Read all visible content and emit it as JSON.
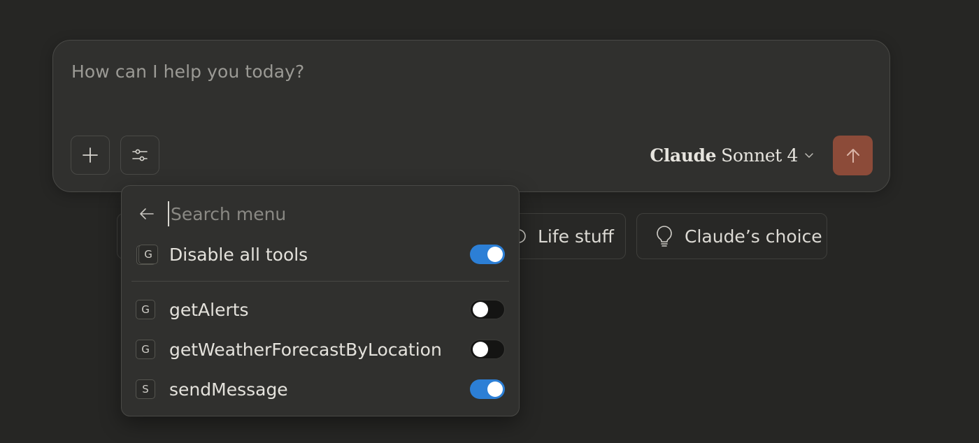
{
  "composer": {
    "placeholder": "How can I help you today?",
    "model_brand": "Claude",
    "model_variant": "Sonnet 4"
  },
  "suggestions": [
    {
      "label": "Life stuff",
      "icon": "life-stuff-icon"
    },
    {
      "label": "Claude’s choice",
      "icon": "lightbulb-icon"
    }
  ],
  "menu": {
    "search_placeholder": "Search menu",
    "items": [
      {
        "badge": "G",
        "label": "Disable all tools",
        "enabled": true
      },
      {
        "badge": "G",
        "label": "getAlerts",
        "enabled": false
      },
      {
        "badge": "G",
        "label": "getWeatherForecastByLocation",
        "enabled": false
      },
      {
        "badge": "S",
        "label": "sendMessage",
        "enabled": true
      }
    ]
  },
  "colors": {
    "background": "#262624",
    "send_button": "#8c4b39",
    "toggle_on": "#2c7fd6"
  }
}
